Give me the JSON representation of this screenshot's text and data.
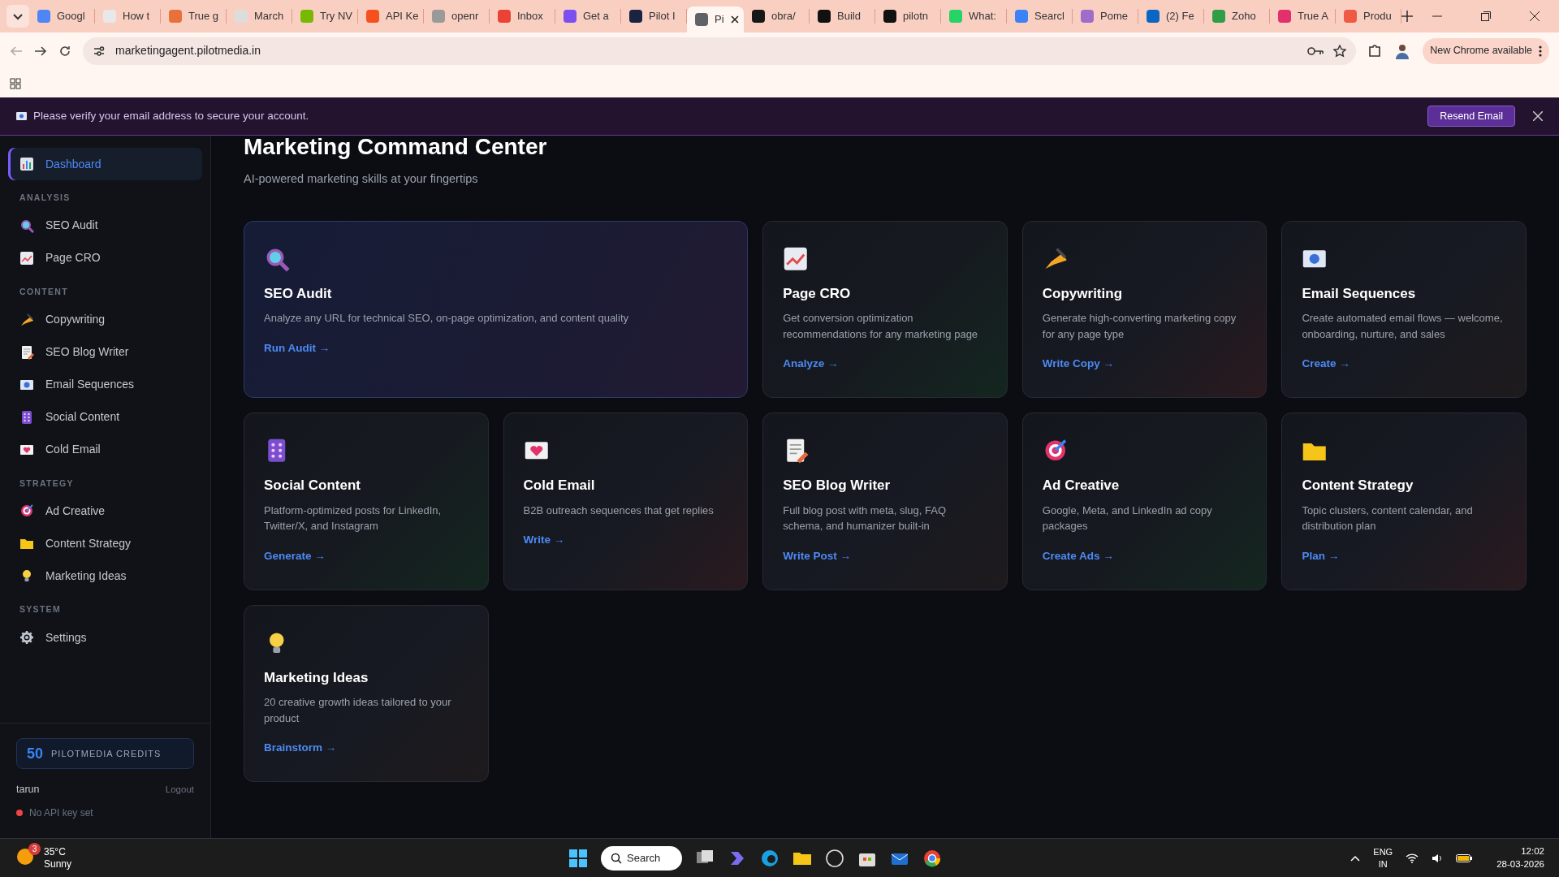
{
  "browser": {
    "tabs": [
      {
        "label": "Googl",
        "color": "#4f86f7",
        "selected": false
      },
      {
        "label": "How t",
        "color": "#e8e8e8",
        "selected": false
      },
      {
        "label": "True g",
        "color": "#e8703a",
        "selected": false
      },
      {
        "label": "March",
        "color": "#dddddd",
        "selected": false
      },
      {
        "label": "Try NV",
        "color": "#76b900",
        "selected": false
      },
      {
        "label": "API Ke",
        "color": "#f4511e",
        "selected": false
      },
      {
        "label": "openr",
        "color": "#9a9a9a",
        "selected": false
      },
      {
        "label": "Inbox",
        "color": "#ea4335",
        "selected": false
      },
      {
        "label": "Get a",
        "color": "#7b4ff0",
        "selected": false
      },
      {
        "label": "Pilot I",
        "color": "#1a2340",
        "selected": false
      },
      {
        "label": "Pi",
        "color": "#5f6368",
        "selected": true
      },
      {
        "label": "obra/",
        "color": "#181717",
        "selected": false
      },
      {
        "label": "Build",
        "color": "#111111",
        "selected": false
      },
      {
        "label": "pilotn",
        "color": "#111111",
        "selected": false
      },
      {
        "label": "What:",
        "color": "#25d366",
        "selected": false
      },
      {
        "label": "Searcl",
        "color": "#3b82f6",
        "selected": false
      },
      {
        "label": "Pome",
        "color": "#a06cc9",
        "selected": false
      },
      {
        "label": "(2) Fe",
        "color": "#0a66c2",
        "selected": false
      },
      {
        "label": "Zoho",
        "color": "#2f9e44",
        "selected": false
      },
      {
        "label": "True A",
        "color": "#e1306c",
        "selected": false
      },
      {
        "label": "Produ",
        "color": "#ef5a44",
        "selected": false
      }
    ],
    "url": "marketingagent.pilotmedia.in",
    "update_button": "New Chrome available"
  },
  "banner": {
    "text": "Please verify your email address to secure your account.",
    "button": "Resend Email"
  },
  "sidebar": {
    "sections": [
      {
        "items": [
          {
            "label": "Dashboard",
            "selected": true
          }
        ]
      },
      {
        "heading": "ANALYSIS",
        "items": [
          {
            "label": "SEO Audit",
            "selected": false
          },
          {
            "label": "Page CRO",
            "selected": false
          }
        ]
      },
      {
        "heading": "CONTENT",
        "items": [
          {
            "label": "Copywriting",
            "selected": false
          },
          {
            "label": "SEO Blog Writer",
            "selected": false
          },
          {
            "label": "Email Sequences",
            "selected": false
          },
          {
            "label": "Social Content",
            "selected": false
          },
          {
            "label": "Cold Email",
            "selected": false
          }
        ]
      },
      {
        "heading": "STRATEGY",
        "items": [
          {
            "label": "Ad Creative",
            "selected": false
          },
          {
            "label": "Content Strategy",
            "selected": false
          },
          {
            "label": "Marketing Ideas",
            "selected": false
          }
        ]
      },
      {
        "heading": "SYSTEM",
        "items": [
          {
            "label": "Settings",
            "selected": false
          }
        ]
      }
    ],
    "credits": {
      "count": "50",
      "label": "PILOTMEDIA CREDITS"
    },
    "user": "tarun",
    "logout": "Logout",
    "api_status": {
      "text": "No API key set",
      "color": "#ef4444"
    }
  },
  "main": {
    "title": "Marketing Command Center",
    "subtitle": "AI-powered marketing skills at your fingertips",
    "cards": [
      {
        "title": "SEO Audit",
        "description": "Analyze any URL for technical SEO, on-page optimization, and content quality",
        "link": "Run Audit →",
        "featured": true
      },
      {
        "title": "Page CRO",
        "description": "Get conversion optimization recommendations for any marketing page",
        "link": "Analyze →",
        "featured": false
      },
      {
        "title": "Copywriting",
        "description": "Generate high-converting marketing copy for any page type",
        "link": "Write Copy →",
        "featured": false
      },
      {
        "title": "Email Sequences",
        "description": "Create automated email flows — welcome, onboarding, nurture, and sales",
        "link": "Create →",
        "featured": false
      },
      {
        "title": "Social Content",
        "description": "Platform-optimized posts for LinkedIn, Twitter/X, and Instagram",
        "link": "Generate →",
        "featured": false
      },
      {
        "title": "Cold Email",
        "description": "B2B outreach sequences that get replies",
        "link": "Write →",
        "featured": false
      },
      {
        "title": "SEO Blog Writer",
        "description": "Full blog post with meta, slug, FAQ schema, and humanizer built-in",
        "link": "Write Post →",
        "featured": false
      },
      {
        "title": "Ad Creative",
        "description": "Google, Meta, and LinkedIn ad copy packages",
        "link": "Create Ads →",
        "featured": false
      },
      {
        "title": "Content Strategy",
        "description": "Topic clusters, content calendar, and distribution plan",
        "link": "Plan →",
        "featured": false
      },
      {
        "title": "Marketing Ideas",
        "description": "20 creative growth ideas tailored to your product",
        "link": "Brainstorm →",
        "featured": false
      }
    ]
  },
  "taskbar": {
    "weather": {
      "temperature": "35°C",
      "condition": "Sunny",
      "badge": "3"
    },
    "search": "Search",
    "language": "ENG",
    "region": "IN",
    "time": "12:02",
    "date": "28-03-2026"
  }
}
